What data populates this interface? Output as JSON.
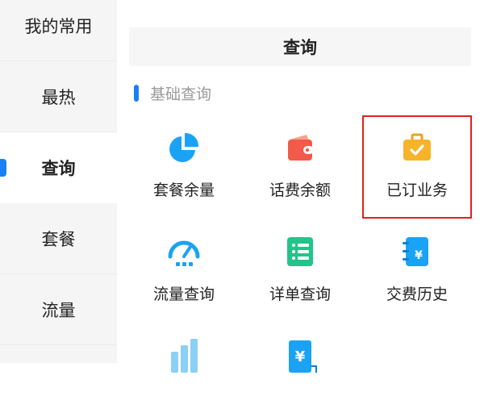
{
  "sidebar": {
    "items": [
      {
        "label": "我的常用"
      },
      {
        "label": "最热"
      },
      {
        "label": "查询",
        "active": true
      },
      {
        "label": "套餐"
      },
      {
        "label": "流量"
      }
    ]
  },
  "header": {
    "title": "查询"
  },
  "section": {
    "title": "基础查询"
  },
  "grid": {
    "items": [
      {
        "label": "套餐余量",
        "icon": "pie-chart-icon"
      },
      {
        "label": "话费余额",
        "icon": "wallet-icon"
      },
      {
        "label": "已订业务",
        "icon": "briefcase-check-icon"
      },
      {
        "label": "流量查询",
        "icon": "speedometer-icon"
      },
      {
        "label": "详单查询",
        "icon": "list-document-icon"
      },
      {
        "label": "交费历史",
        "icon": "payment-notebook-icon"
      },
      {
        "label": "",
        "icon": "bar-chart-icon"
      },
      {
        "label": "",
        "icon": "yen-document-icon"
      }
    ]
  },
  "colors": {
    "accent_blue": "#1a7ff5",
    "icon_blue": "#1aa3f5",
    "icon_red": "#f25a4a",
    "icon_orange": "#f7b32a",
    "icon_green": "#22c48a",
    "highlight_red": "#e02020"
  }
}
